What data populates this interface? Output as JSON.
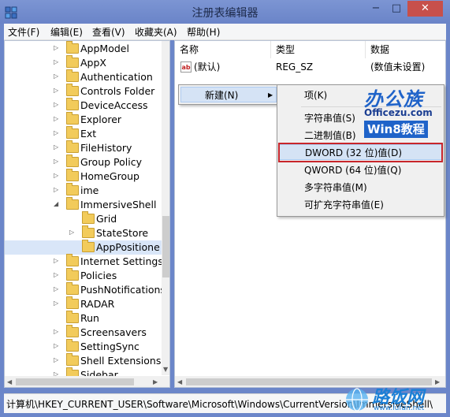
{
  "window": {
    "title": "注册表编辑器",
    "controls": {
      "minimize": "−",
      "maximize": "□",
      "close": "✕"
    }
  },
  "menubar": {
    "items": [
      "文件(F)",
      "编辑(E)",
      "查看(V)",
      "收藏夹(A)",
      "帮助(H)"
    ]
  },
  "tree": {
    "items": [
      {
        "label": "AppModel",
        "expander": "▷",
        "level": 0
      },
      {
        "label": "AppX",
        "expander": "▷",
        "level": 0
      },
      {
        "label": "Authentication",
        "expander": "▷",
        "level": 0
      },
      {
        "label": "Controls Folder",
        "expander": "▷",
        "level": 0
      },
      {
        "label": "DeviceAccess",
        "expander": "▷",
        "level": 0
      },
      {
        "label": "Explorer",
        "expander": "▷",
        "level": 0
      },
      {
        "label": "Ext",
        "expander": "▷",
        "level": 0
      },
      {
        "label": "FileHistory",
        "expander": "▷",
        "level": 0
      },
      {
        "label": "Group Policy",
        "expander": "▷",
        "level": 0
      },
      {
        "label": "HomeGroup",
        "expander": "▷",
        "level": 0
      },
      {
        "label": "ime",
        "expander": "▷",
        "level": 0
      },
      {
        "label": "ImmersiveShell",
        "expander": "◢",
        "level": 0
      },
      {
        "label": "Grid",
        "expander": "",
        "level": 1
      },
      {
        "label": "StateStore",
        "expander": "▷",
        "level": 1
      },
      {
        "label": "AppPositione",
        "expander": "",
        "level": 1,
        "selected": true
      },
      {
        "label": "Internet Settings",
        "expander": "▷",
        "level": 0
      },
      {
        "label": "Policies",
        "expander": "▷",
        "level": 0
      },
      {
        "label": "PushNotifications",
        "expander": "▷",
        "level": 0
      },
      {
        "label": "RADAR",
        "expander": "▷",
        "level": 0
      },
      {
        "label": "Run",
        "expander": "",
        "level": 0
      },
      {
        "label": "Screensavers",
        "expander": "▷",
        "level": 0
      },
      {
        "label": "SettingSync",
        "expander": "▷",
        "level": 0
      },
      {
        "label": "Shell Extensions",
        "expander": "▷",
        "level": 0
      },
      {
        "label": "Sidebar",
        "expander": "▷",
        "level": 0
      }
    ]
  },
  "list": {
    "headers": {
      "name": "名称",
      "type": "类型",
      "data": "数据"
    },
    "rows": [
      {
        "icon": "ab",
        "name": "(默认)",
        "type": "REG_SZ",
        "data": "(数值未设置)"
      }
    ]
  },
  "context_menu": {
    "new_label": "新建(N)",
    "submenu_arrow": "▶"
  },
  "submenu": {
    "items": [
      "项(K)",
      "字符串值(S)",
      "二进制值(B)",
      "DWORD (32 位)值(D)",
      "QWORD (64 位)值(Q)",
      "多字符串值(M)",
      "可扩充字符串值(E)"
    ],
    "highlighted": "DWORD (32 位)值(D)"
  },
  "watermark": {
    "brand_cn": "办公族",
    "url": "Officezu.com",
    "tag": "Win8教程",
    "bottom_cn": "路饭网",
    "bottom_url": "www.lufan.net"
  },
  "statusbar": {
    "path": "计算机\\HKEY_CURRENT_USER\\Software\\Microsoft\\Windows\\CurrentVersion\\ImmersiveShell\\"
  },
  "scroll_arrows": {
    "up": "▲",
    "down": "▼",
    "left": "◀",
    "right": "▶"
  }
}
